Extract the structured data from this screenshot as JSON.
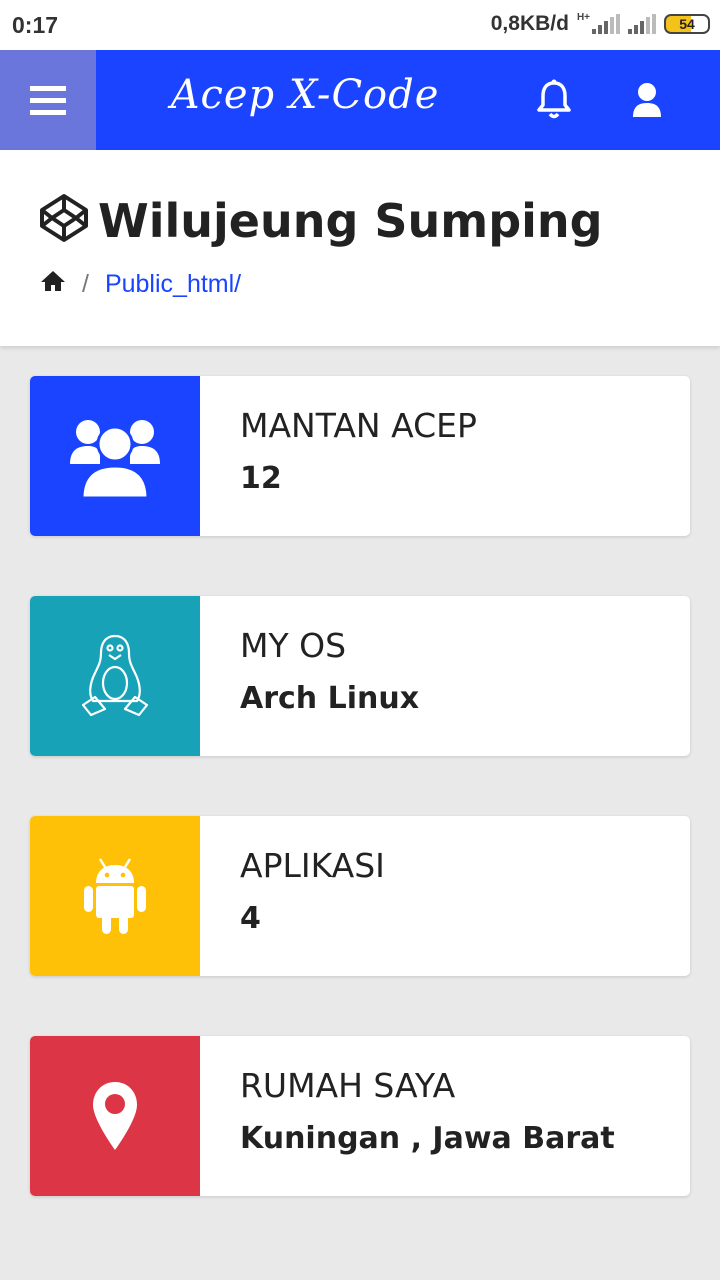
{
  "status_bar": {
    "time": "0:17",
    "net_speed": "0,8KB/d",
    "network_type": "H+",
    "battery": "54"
  },
  "navbar": {
    "brand": "Acep X-Code",
    "menu_icon": "hamburger-icon",
    "notification_icon": "bell-icon",
    "user_icon": "user-icon",
    "color": "#1a44ff"
  },
  "header": {
    "title": "Wilujeung Sumping",
    "title_icon": "codepen-icon",
    "breadcrumb": {
      "home_icon": "home-icon",
      "separator": "/",
      "path": "Public_html/"
    }
  },
  "cards": [
    {
      "label": "MANTAN ACEP",
      "value": "12",
      "icon": "users-icon",
      "color": "#1a44ff"
    },
    {
      "label": "MY OS",
      "value": "Arch Linux",
      "icon": "linux-icon",
      "color": "#17a2b8"
    },
    {
      "label": "APLIKASI",
      "value": "4",
      "icon": "android-icon",
      "color": "#ffc107"
    },
    {
      "label": "RUMAH SAYA",
      "value": "Kuningan , Jawa Barat",
      "icon": "map-marker-icon",
      "color": "#dc3545"
    }
  ]
}
